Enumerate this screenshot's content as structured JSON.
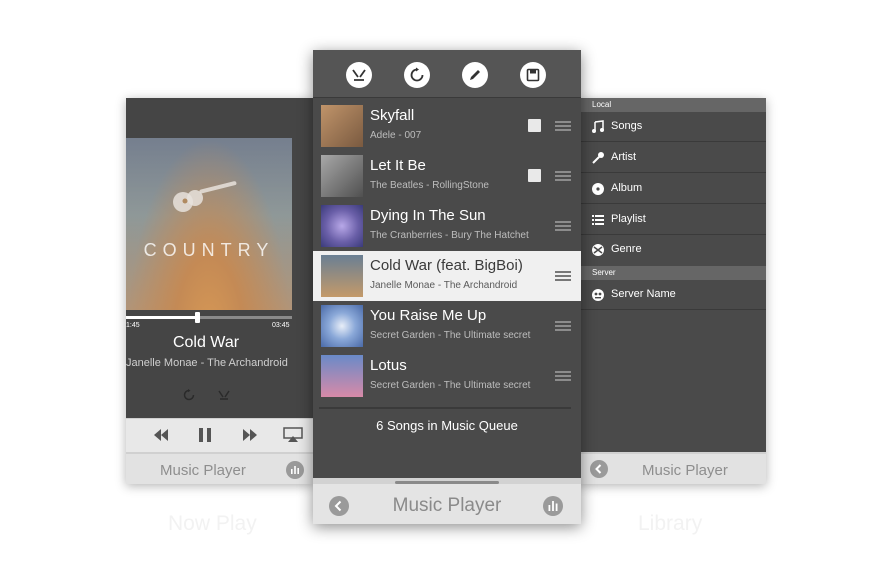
{
  "now_play": {
    "genre_text": "COUNTRY",
    "elapsed": "1:45",
    "total": "03:45",
    "progress": 0.43,
    "title": "Cold War",
    "subtitle": "Janelle Monae - The Archandroid",
    "footer_title": "Music Player",
    "caption": "Now Play"
  },
  "queue": {
    "toolbar": [
      "share-icon",
      "repeat-icon",
      "edit-icon",
      "save-icon"
    ],
    "songs": [
      {
        "title": "Skyfall",
        "subtitle": "Adele - 007",
        "downloaded": true,
        "active": false,
        "thumb": "#a87a5a"
      },
      {
        "title": "Let It Be",
        "subtitle": "The Beatles - RollingStone",
        "downloaded": true,
        "active": false,
        "thumb": "#8a8a8a"
      },
      {
        "title": "Dying In The Sun",
        "subtitle": "The Cranberries - Bury The Hatchet",
        "downloaded": false,
        "active": false,
        "thumb": "#6a5fa8"
      },
      {
        "title": "Cold War (feat. BigBoi)",
        "subtitle": "Janelle Monae - The Archandroid",
        "downloaded": false,
        "active": true,
        "thumb": "#b08a60"
      },
      {
        "title": "You Raise Me Up",
        "subtitle": "Secret Garden - The Ultimate secret",
        "downloaded": false,
        "active": false,
        "thumb": "#6a8ac8"
      },
      {
        "title": "Lotus",
        "subtitle": "Secret Garden - The Ultimate secret",
        "downloaded": false,
        "active": false,
        "thumb": "#b07a98"
      }
    ],
    "count_text": "6 Songs in Music Queue",
    "footer_title": "Music Player"
  },
  "library": {
    "local_header": "Local",
    "items": [
      {
        "label": "Songs",
        "icon": "music-note-icon"
      },
      {
        "label": "Artist",
        "icon": "microphone-icon"
      },
      {
        "label": "Album",
        "icon": "disc-icon"
      },
      {
        "label": "Playlist",
        "icon": "list-icon"
      },
      {
        "label": "Genre",
        "icon": "genre-icon"
      }
    ],
    "server_header": "Server",
    "server_item": {
      "label": "Server Name",
      "icon": "server-icon"
    },
    "footer_title": "Music Player",
    "caption": "Library"
  }
}
